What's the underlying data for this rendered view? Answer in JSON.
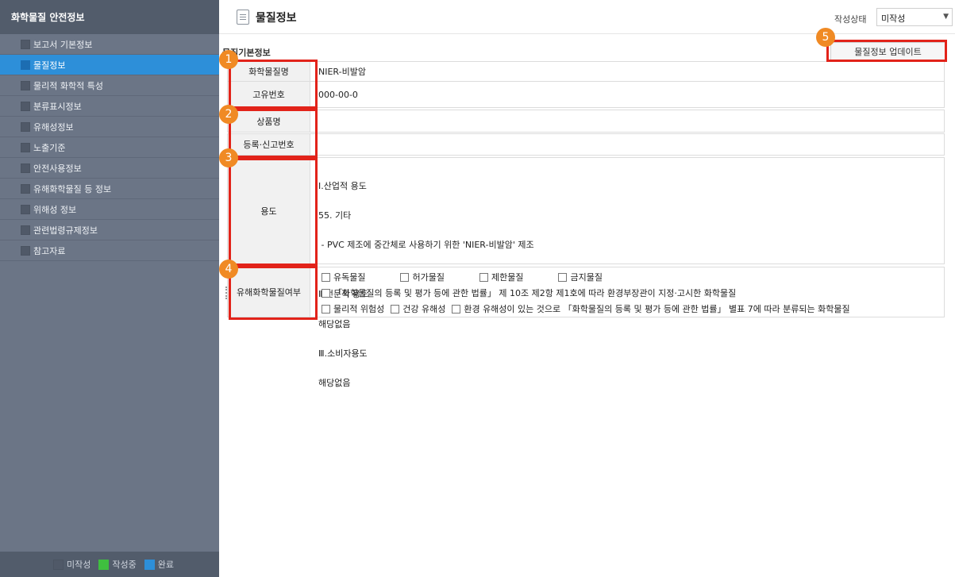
{
  "sidebar": {
    "title": "화학물질 안전정보",
    "items": [
      {
        "label": "보고서 기본정보"
      },
      {
        "label": "물질정보"
      },
      {
        "label": "물리적 화학적 특성"
      },
      {
        "label": "분류표시정보"
      },
      {
        "label": "유해성정보"
      },
      {
        "label": "노출기준"
      },
      {
        "label": "안전사용정보"
      },
      {
        "label": "유해화학물질 등 정보"
      },
      {
        "label": "위해성 정보"
      },
      {
        "label": "관련법령규제정보"
      },
      {
        "label": "참고자료"
      }
    ],
    "active_index": 1,
    "legend": {
      "not_written": "미작성",
      "in_progress": "작성중",
      "complete": "완료"
    }
  },
  "colors": {
    "not_written": "#505968",
    "in_progress": "#3fbf3f",
    "complete": "#2d8fd9",
    "highlight": "#e2231a",
    "badge": "#f08a24"
  },
  "header": {
    "icon": "document-icon",
    "title": "물질정보",
    "status_label": "작성상태",
    "status_value": "미작성"
  },
  "section": {
    "title": "물질기본정보",
    "update_button": "물질정보 업데이트"
  },
  "form": {
    "chemical_name": {
      "label": "화학물질명",
      "value": "NIER-비발암"
    },
    "unique_number": {
      "label": "고유번호",
      "value": "000-00-0"
    },
    "product_name": {
      "label": "상품명",
      "value": ""
    },
    "registration_number": {
      "label": "등록·신고번호",
      "value": ""
    },
    "usage": {
      "label": "용도",
      "lines": [
        "Ⅰ.산업적 용도",
        "55. 기타",
        " - PVC 제조에 중간체로 사용하기 위한 'NIER-비발암' 제조",
        "",
        "Ⅱ.전문적 용도",
        "해당없음",
        "Ⅲ.소비자용도",
        "해당없음"
      ]
    },
    "hazardous": {
      "label": "유해화학물질여부",
      "line1": [
        "유독물질",
        "허가물질",
        "제한물질",
        "금지물질"
      ],
      "line2": "「화학물질의 등록 및 평가 등에 관한 법률」 제 10조 제2항 제1호에 따라 환경부장관이 지정·고시한 화학물질",
      "line3": [
        "물리적 위험성",
        "건강 유해성",
        "환경 유해성이 있는 것으로 「화학물질의 등록 및 평가 등에 관한 법률」 별표 7에 따라 분류되는 화학물질"
      ]
    }
  },
  "annotations": [
    "1",
    "2",
    "3",
    "4",
    "5"
  ]
}
